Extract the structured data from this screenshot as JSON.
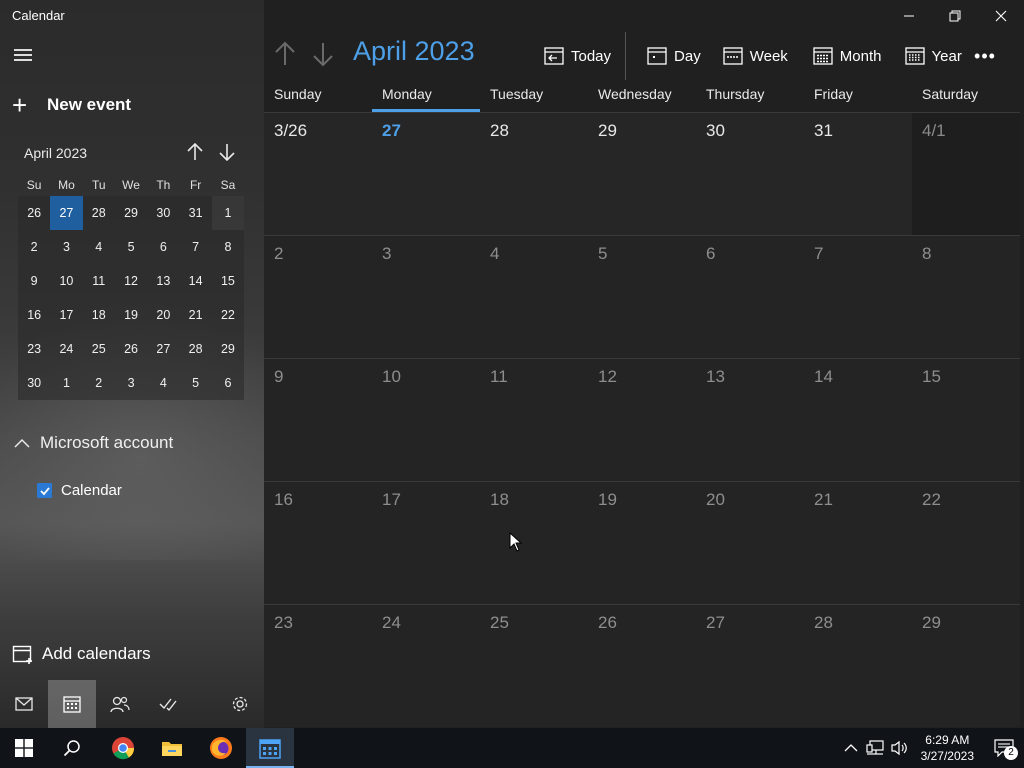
{
  "app": {
    "title": "Calendar"
  },
  "sidebar": {
    "new_event_label": "New event",
    "mini_calendar": {
      "month_label": "April 2023",
      "weekdays": [
        "Su",
        "Mo",
        "Tu",
        "We",
        "Th",
        "Fr",
        "Sa"
      ],
      "days": [
        "26",
        "27",
        "28",
        "29",
        "30",
        "31",
        "1",
        "2",
        "3",
        "4",
        "5",
        "6",
        "7",
        "8",
        "9",
        "10",
        "11",
        "12",
        "13",
        "14",
        "15",
        "16",
        "17",
        "18",
        "19",
        "20",
        "21",
        "22",
        "23",
        "24",
        "25",
        "26",
        "27",
        "28",
        "29",
        "30",
        "1",
        "2",
        "3",
        "4",
        "5",
        "6"
      ],
      "selected_index": 1
    },
    "account_label": "Microsoft account",
    "calendar_item_label": "Calendar",
    "calendar_checked": true,
    "add_calendars_label": "Add calendars"
  },
  "main": {
    "month_title": "April 2023",
    "toolbar": {
      "today_label": "Today",
      "day_label": "Day",
      "week_label": "Week",
      "month_label": "Month",
      "year_label": "Year"
    },
    "weekdays": [
      "Sunday",
      "Monday",
      "Tuesday",
      "Wednesday",
      "Thursday",
      "Friday",
      "Saturday"
    ],
    "today_weekday_index": 1,
    "grid": [
      [
        "3/26",
        "27",
        "28",
        "29",
        "30",
        "31",
        "4/1"
      ],
      [
        "2",
        "3",
        "4",
        "5",
        "6",
        "7",
        "8"
      ],
      [
        "9",
        "10",
        "11",
        "12",
        "13",
        "14",
        "15"
      ],
      [
        "16",
        "17",
        "18",
        "19",
        "20",
        "21",
        "22"
      ],
      [
        "23",
        "24",
        "25",
        "26",
        "27",
        "28",
        "29"
      ]
    ]
  },
  "taskbar": {
    "time": "6:29 AM",
    "date": "3/27/2023",
    "notification_count": "2"
  },
  "colors": {
    "accent": "#4d9fe8",
    "selected_day": "#1f5fa0"
  }
}
